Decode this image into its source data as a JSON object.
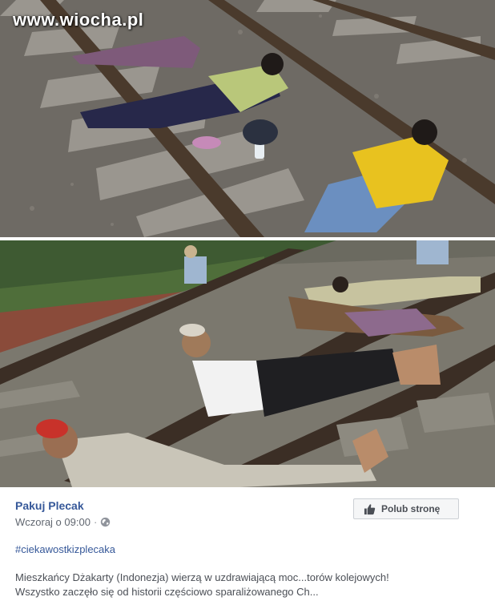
{
  "watermark": "www.wiocha.pl",
  "post": {
    "page_name": "Pakuj Plecak",
    "timestamp": "Wczoraj o 09:00",
    "separator": "·",
    "privacy_icon": "globe-icon",
    "like_page_label": "Polub stronę",
    "like_icon": "thumbs-up-icon",
    "hashtag": "#ciekawostkizplecaka",
    "description_line1": "Mieszkańcy Dżakarty (Indonezja) wierzą w uzdrawiającą moc...torów kolejowych!",
    "description_line2": "Wszystko zaczęło się od historii częściowo sparaliżowanego Ch..."
  },
  "colors": {
    "link": "#365899",
    "meta_text": "#616770",
    "body_text": "#4b4f56",
    "button_bg": "#f5f6f7",
    "button_border": "#ccd0d5"
  }
}
